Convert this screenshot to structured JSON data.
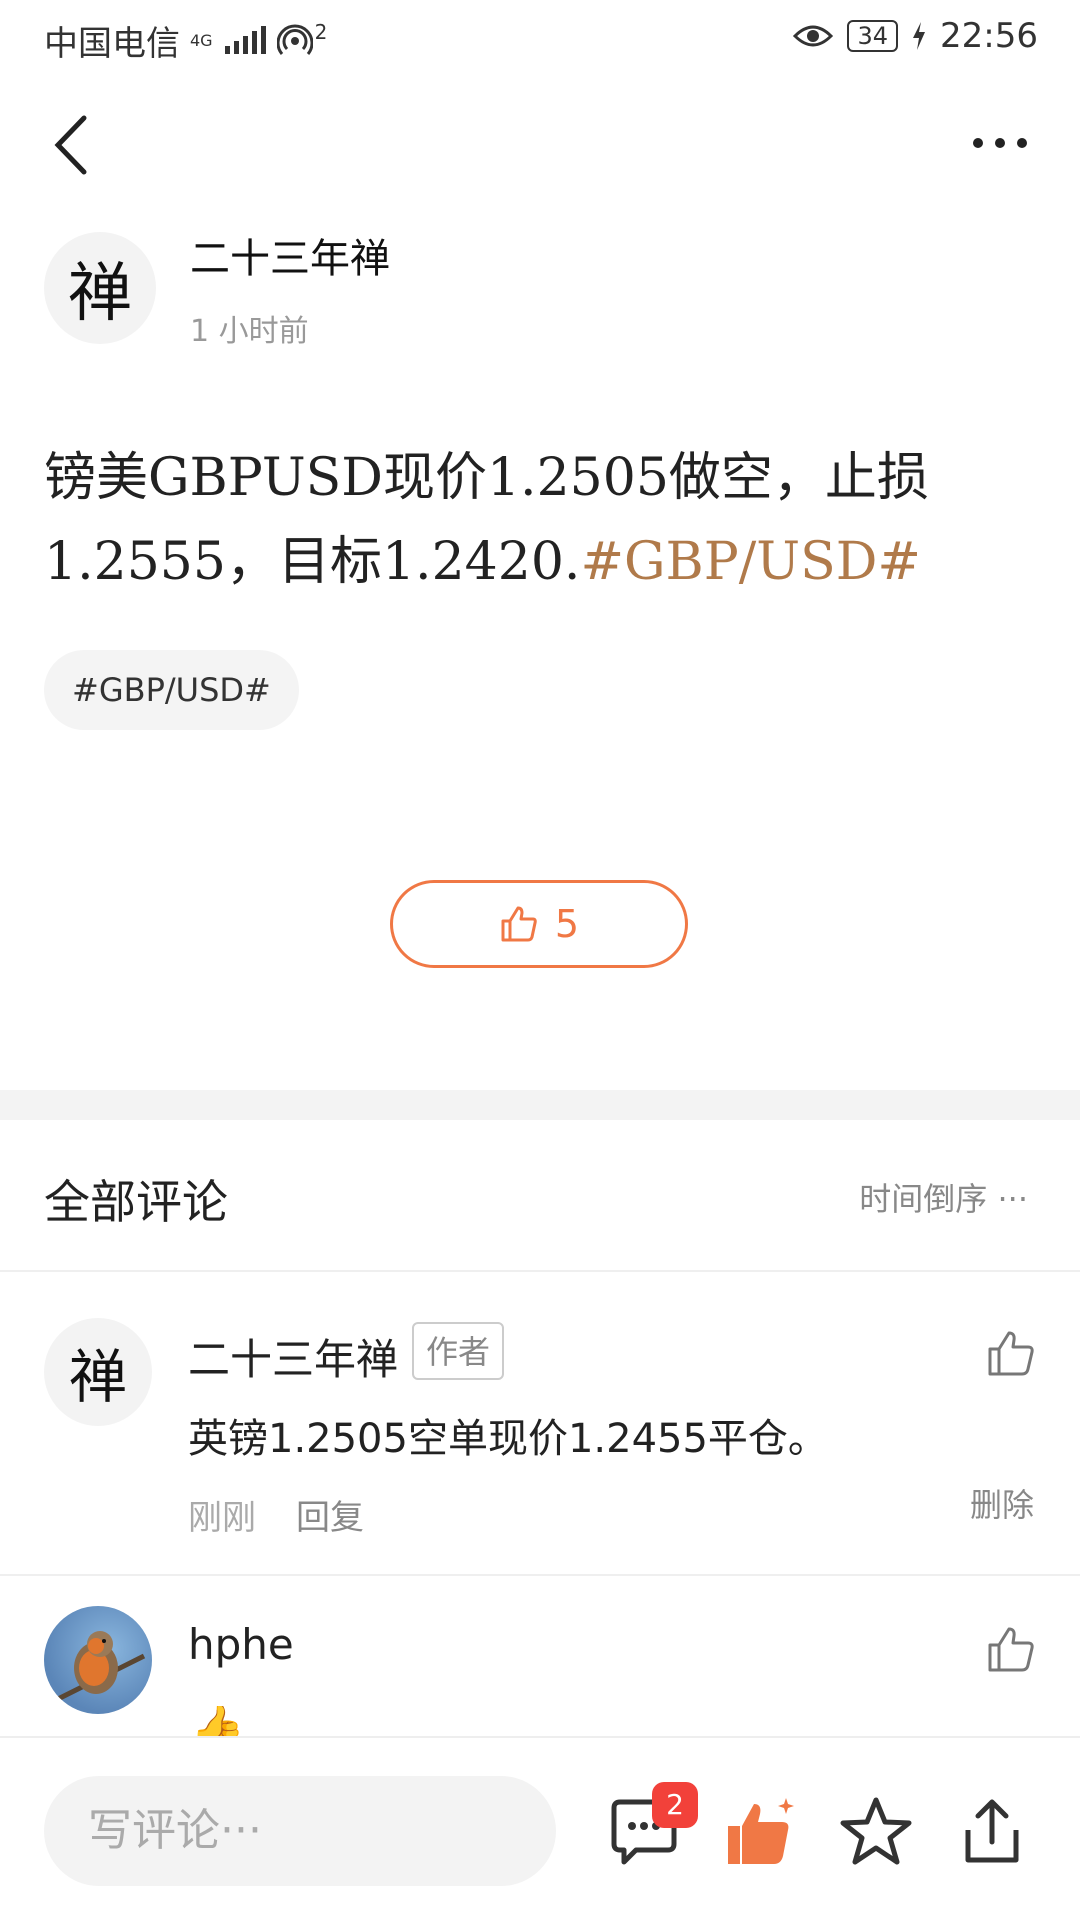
{
  "status_bar": {
    "carrier": "中国电信",
    "network": "4G",
    "hotspot_count": "2",
    "battery": "34",
    "time": "22:56"
  },
  "post": {
    "author_name": "二十三年禅",
    "avatar_glyph": "禅",
    "time": "1 小时前",
    "text_main": "镑美GBPUSD现价1.2505做空，止损1.2555，目标1.2420.",
    "text_tag": "#GBP/USD#",
    "tag_chip": "#GBP/USD#",
    "like_count": "5"
  },
  "comments": {
    "header": "全部评论",
    "sort_label": "时间倒序 ···",
    "items": [
      {
        "name": "二十三年禅",
        "avatar_glyph": "禅",
        "badge": "作者",
        "text": "英镑1.2505空单现价1.2455平仓。",
        "time": "刚刚",
        "reply_label": "回复",
        "delete_label": "删除"
      },
      {
        "name": "hphe",
        "emoji": "👍"
      }
    ]
  },
  "bottom_bar": {
    "placeholder": "写评论···",
    "comment_badge": "2"
  },
  "colors": {
    "accent": "#f07845",
    "tag_text": "#b07a4a",
    "badge_red": "#f2413a"
  },
  "icons": [
    "back-icon",
    "more-icon",
    "thumbs-up-icon",
    "comment-icon",
    "star-icon",
    "share-icon"
  ]
}
